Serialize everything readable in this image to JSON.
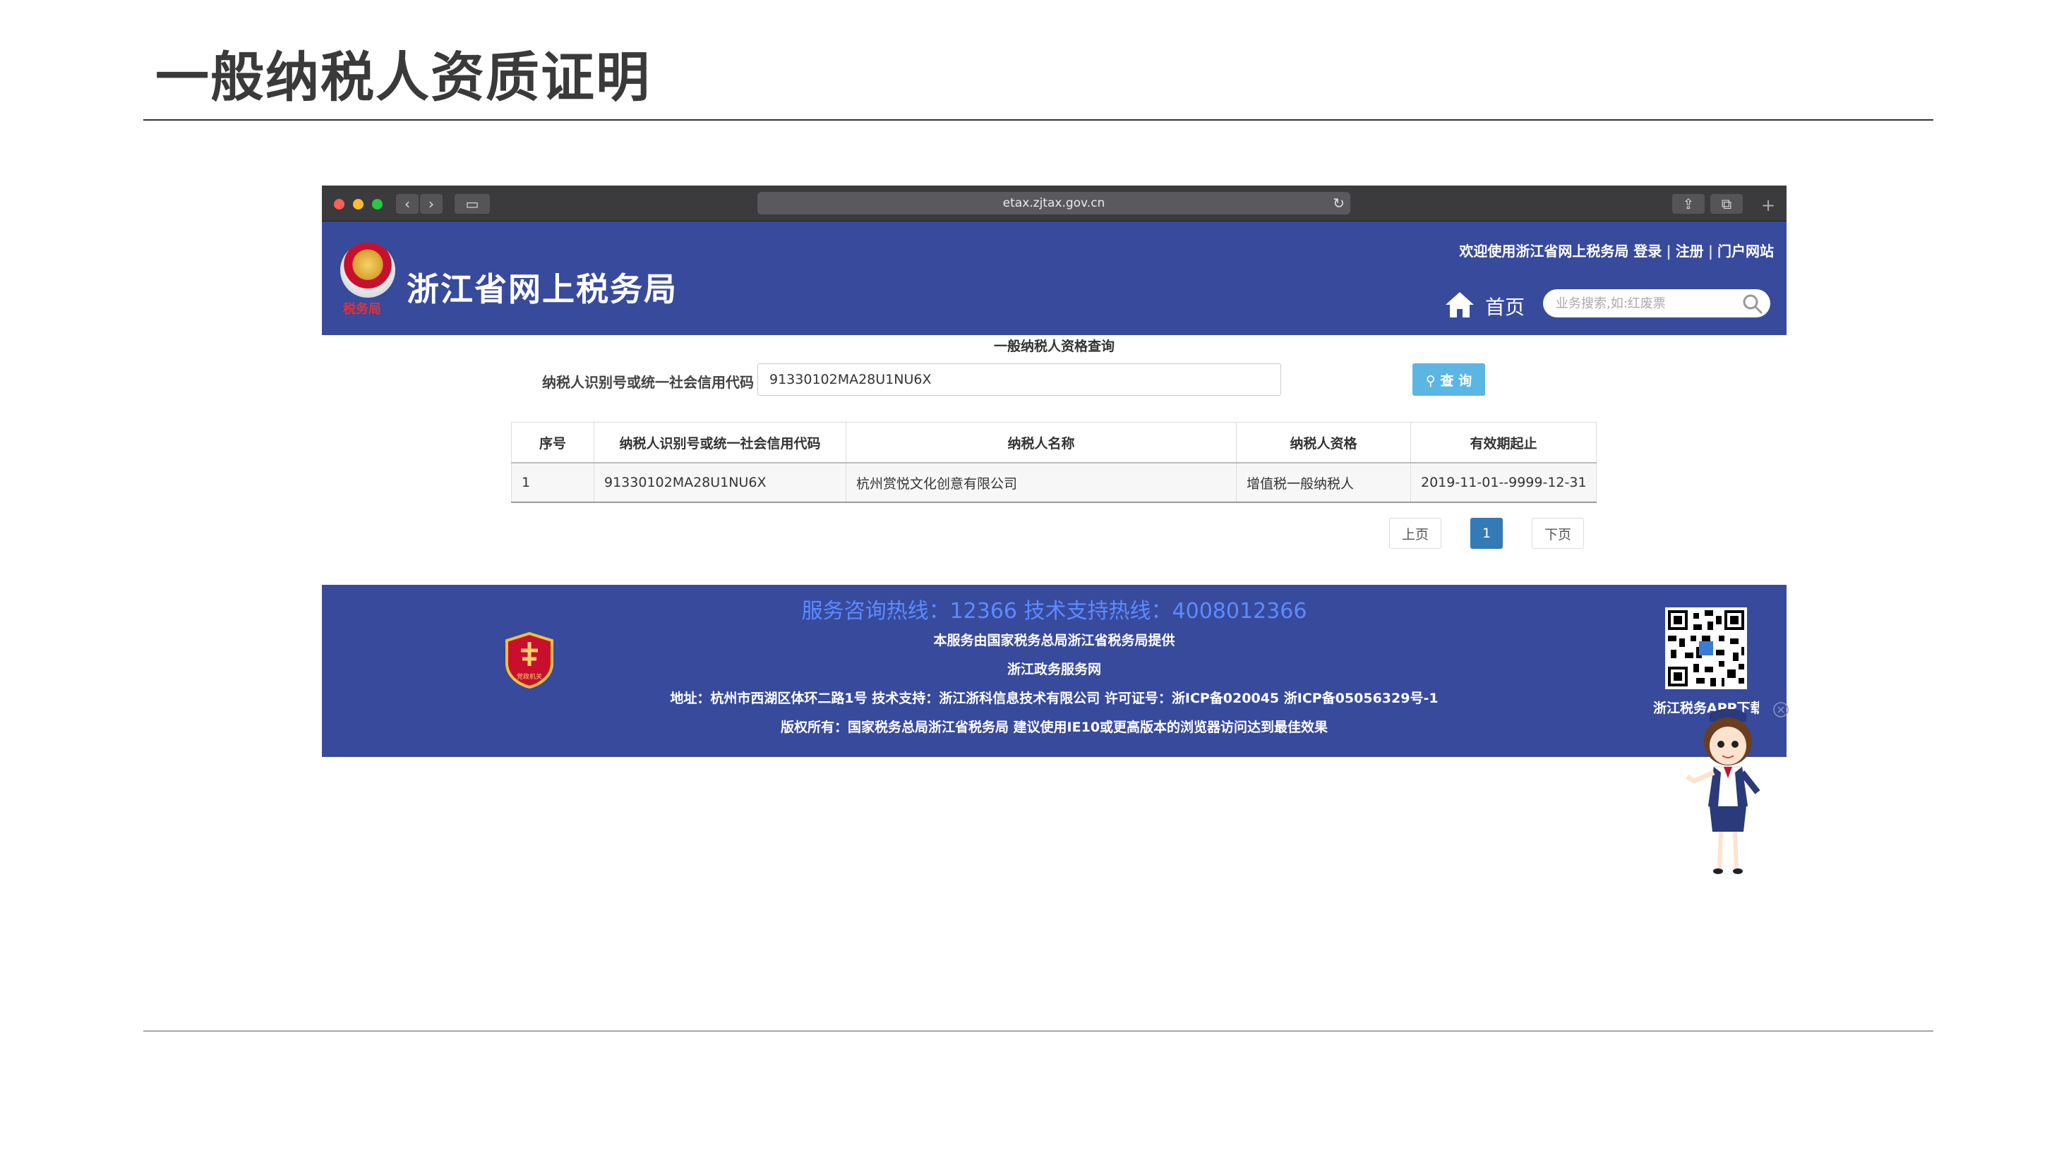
{
  "slide": {
    "title": "一般纳税人资质证明"
  },
  "browser": {
    "url": "etax.zjtax.gov.cn"
  },
  "site": {
    "name": "浙江省网上税务局",
    "emblem_tag": "税务局",
    "welcome": "欢迎使用浙江省网上税务局",
    "login": "登录",
    "register": "注册",
    "portal": "门户网站",
    "home_label": "首页",
    "search_placeholder": "业务搜索,如:红废票"
  },
  "query": {
    "title": "一般纳税人资格查询",
    "label": "纳税人识别号或统一社会信用代码",
    "value": "91330102MA28U1NU6X",
    "button": "查 询"
  },
  "table": {
    "headers": [
      "序号",
      "纳税人识别号或统一社会信用代码",
      "纳税人名称",
      "纳税人资格",
      "有效期起止"
    ],
    "rows": [
      [
        "1",
        "91330102MA28U1NU6X",
        "杭州赏悦文化创意有限公司",
        "增值税一般纳税人",
        "2019-11-01--9999-12-31"
      ]
    ]
  },
  "pagination": {
    "prev": "上页",
    "current": "1",
    "next": "下页"
  },
  "footer": {
    "hotline": "服务咨询热线：12366 技术支持热线：4008012366",
    "provider": "本服务由国家税务总局浙江省税务局提供",
    "service": "浙江政务服务网",
    "address": "地址：杭州市西湖区体环二路1号 技术支持：浙江浙科信息技术有限公司 许可证号：浙ICP备020045 浙ICP备05056329号-1",
    "copyright": "版权所有：国家税务总局浙江省税务局 建议使用IE10或更高版本的浏览器访问达到最佳效果",
    "badge_text": "党政机关",
    "qr_label": "浙江税务APP下载"
  },
  "colors": {
    "header_bg": "#384a9c",
    "hotline": "#5b8cff",
    "query_button": "#5bb6e4",
    "page_current": "#337ab7"
  }
}
